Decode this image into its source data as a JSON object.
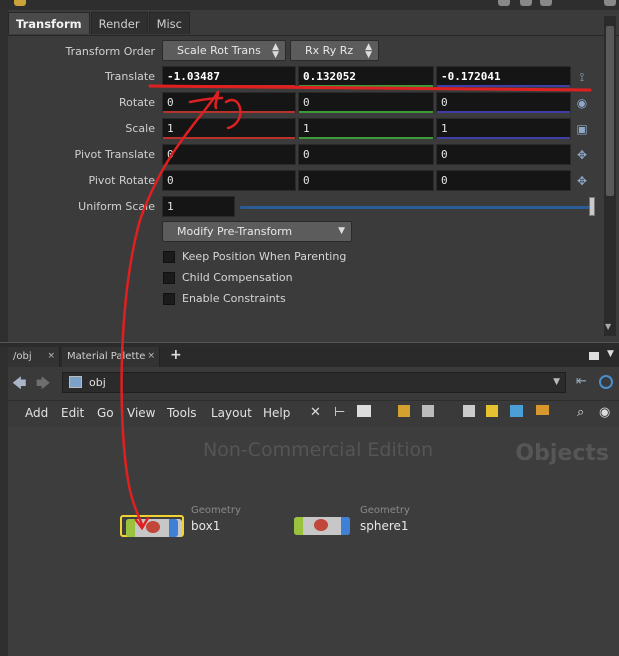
{
  "tabs": [
    "Transform",
    "Render",
    "Misc"
  ],
  "params": {
    "transform_order": {
      "label": "Transform Order",
      "order": "Scale Rot Trans",
      "rot_order": "Rx Ry Rz"
    },
    "translate": {
      "label": "Translate",
      "x": "-1.03487",
      "y": "0.132052",
      "z": "-0.172041"
    },
    "rotate": {
      "label": "Rotate",
      "x": "0",
      "y": "0",
      "z": "0"
    },
    "scale": {
      "label": "Scale",
      "x": "1",
      "y": "1",
      "z": "1"
    },
    "pivot_translate": {
      "label": "Pivot Translate",
      "x": "0",
      "y": "0",
      "z": "0"
    },
    "pivot_rotate": {
      "label": "Pivot Rotate",
      "x": "0",
      "y": "0",
      "z": "0"
    },
    "uniform_scale": {
      "label": "Uniform Scale",
      "value": "1",
      "slider_fraction": 1.0
    },
    "modify_menu": "Modify Pre-Transform",
    "checkboxes": [
      "Keep Position When Parenting",
      "Child Compensation",
      "Enable Constraints"
    ]
  },
  "network": {
    "tabs": [
      "/obj",
      "Material Palette"
    ],
    "add_tab": "+",
    "path": "obj",
    "menus": [
      "Add",
      "Edit",
      "Go",
      "View",
      "Tools",
      "Layout",
      "Help"
    ],
    "watermark": "Non-Commercial Edition",
    "context": "Objects",
    "nodes": [
      {
        "type": "Geometry",
        "name": "box1",
        "selected": true
      },
      {
        "type": "Geometry",
        "name": "sphere1",
        "selected": false
      }
    ]
  },
  "colors": {
    "x_axis": "#b8322c",
    "y_axis": "#3e9a36",
    "z_axis": "#403ca8",
    "annotation": "#e02020",
    "selected_node": "#f0d232"
  }
}
